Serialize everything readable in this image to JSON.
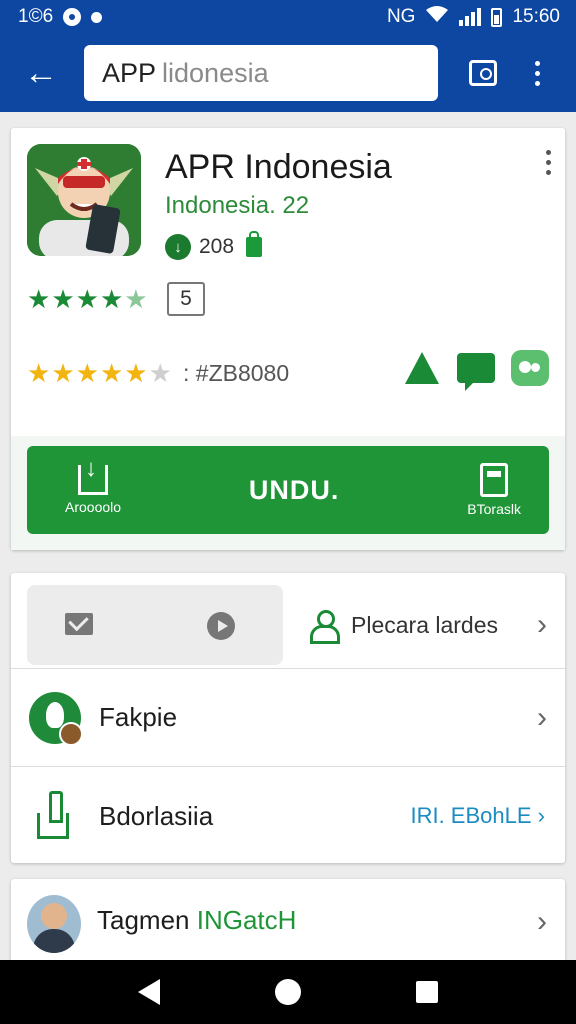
{
  "status_bar": {
    "time_left": "1©6",
    "time_right": "15:60",
    "network": "NG"
  },
  "toolbar": {
    "search_typed": "APP",
    "search_ghost": "lidonesia"
  },
  "app": {
    "title": "APR Indonesia",
    "subtitle": "Indonesia. 22",
    "downloads": "208",
    "rating_box": "5",
    "reviews": ": #ZB8080",
    "install_label": "UNDU.",
    "install_left_caption": "Aroooolo",
    "install_right_caption": "BToraslk"
  },
  "list": {
    "tile_right_label": "Plecara lardes",
    "row2_label": "Fakpie",
    "row3_label": "Bdorlasiia",
    "row3_link": "IRI. EBohLE"
  },
  "bottom": {
    "title_main": "Tagmen ",
    "title_accent": "INGatcH"
  },
  "colors": {
    "toolbar": "#0d47a1",
    "accent_green": "#1f9538",
    "star_gold": "#f2b40f",
    "link_blue": "#1a8cc1"
  },
  "icons": [
    "back-arrow-icon",
    "feedback-icon",
    "more-vert-icon",
    "download-circle-icon",
    "lock-icon",
    "home-icon",
    "chat-icon",
    "game-icon",
    "mail-icon",
    "tag-icon",
    "person-icon",
    "leaf-icon",
    "share-icon",
    "chevron-right-icon"
  ]
}
